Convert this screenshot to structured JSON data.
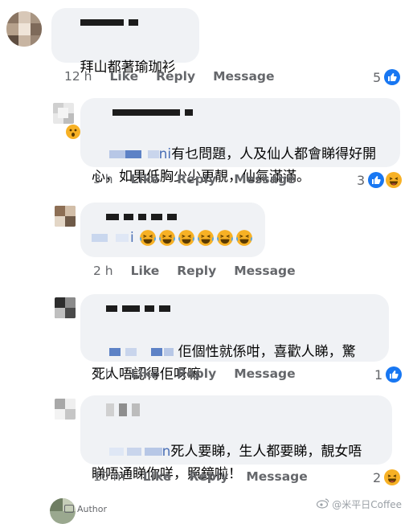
{
  "comments": [
    {
      "text": "拜山都著瑜珈衫",
      "time": "12 h",
      "like_label": "Like",
      "reply_label": "Reply",
      "message_label": "Message",
      "reaction_count": "5",
      "reactions": [
        "like-icon"
      ]
    },
    {
      "text_line1": "有乜問題，人及仙人都會睇得好開",
      "text_line2": "心，如果低胸少少更靚，仙氣滿滿。",
      "mention_fragment": "ni",
      "time": "3 h",
      "like_label": "Like",
      "reply_label": "Reply",
      "message_label": "Message",
      "reaction_count": "3",
      "reactions": [
        "like-icon",
        "haha-icon"
      ]
    },
    {
      "mention_fragment": "i",
      "emojis": [
        "laughing-emoji",
        "laughing-emoji",
        "laughing-emoji",
        "laughing-emoji",
        "laughing-emoji",
        "laughing-emoji"
      ],
      "time": "2 h",
      "like_label": "Like",
      "reply_label": "Reply",
      "message_label": "Message"
    },
    {
      "text_line1": "佢個性就係咁，喜歡人睇，驚",
      "text_line2": "死人唔認得佢呀嘛",
      "time": "1 h",
      "like_label": "Like",
      "reply_label": "Reply",
      "message_label": "Message",
      "reaction_count": "1",
      "reactions": [
        "like-icon"
      ]
    },
    {
      "mention_fragment": "n",
      "text_line1": "死人要睇，生人都要睇，靚女唔",
      "text_line2": "睇唔通睇你咩，照鏡啦！",
      "time": "10 m",
      "like_label": "Like",
      "reply_label": "Reply",
      "message_label": "Message",
      "reaction_count": "2",
      "reactions": [
        "haha-icon"
      ]
    }
  ],
  "footer": {
    "author_label": "Author",
    "watermark": "@米平日Coffee"
  },
  "colors": {
    "bubble": "#f0f2f5",
    "meta": "#65676b",
    "like_blue": "#1877f2",
    "haha_yellow": "#f7b125"
  }
}
